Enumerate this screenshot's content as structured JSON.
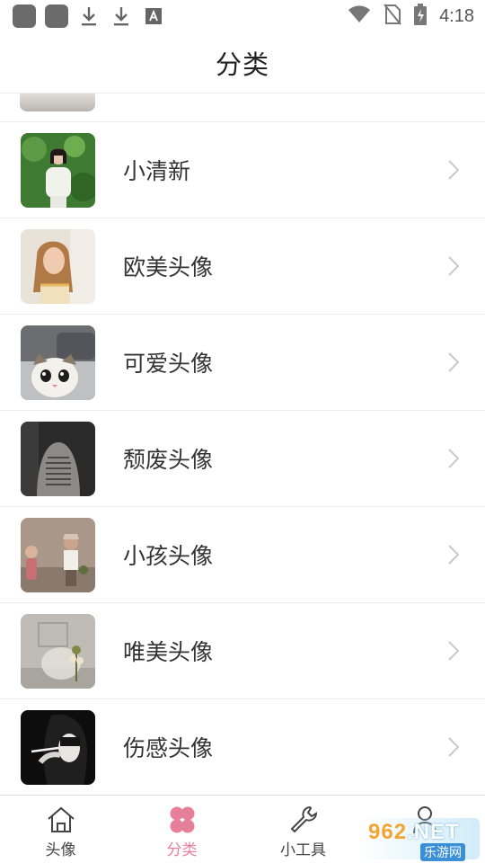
{
  "status_bar": {
    "time": "4:18",
    "left_icons": [
      "app-square-icon",
      "app-square-icon",
      "download-icon",
      "download-icon",
      "font-icon"
    ],
    "right_icons": [
      "wifi-icon",
      "no-sim-icon",
      "battery-charging-icon"
    ]
  },
  "header": {
    "title": "分类"
  },
  "categories": [
    {
      "label": "小清新",
      "icon": "photo-green-girl"
    },
    {
      "label": "欧美头像",
      "icon": "photo-blonde-girl"
    },
    {
      "label": "可爱头像",
      "icon": "photo-cat"
    },
    {
      "label": "颓废头像",
      "icon": "photo-tattoo-back"
    },
    {
      "label": "小孩头像",
      "icon": "photo-kids"
    },
    {
      "label": "唯美头像",
      "icon": "photo-room-flowers"
    },
    {
      "label": "伤感头像",
      "icon": "photo-smoking-girl"
    }
  ],
  "tabs": [
    {
      "label": "头像",
      "icon": "home-icon",
      "active": false
    },
    {
      "label": "分类",
      "icon": "clover-icon",
      "active": true
    },
    {
      "label": "小工具",
      "icon": "wrench-icon",
      "active": false
    },
    {
      "label": "",
      "icon": "user-icon",
      "active": false
    }
  ],
  "watermark": {
    "main": "962",
    "net": ".NET",
    "sub": "乐游网"
  },
  "colors": {
    "accent": "#e87f9a",
    "text": "#333333",
    "divider": "#ececec"
  }
}
